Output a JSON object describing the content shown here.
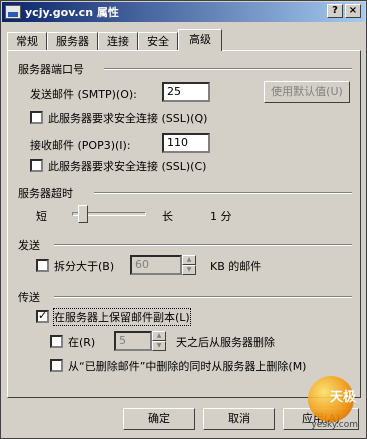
{
  "window": {
    "title": "ycjy.gov.cn 属性",
    "help_label": "?",
    "close_label": "×"
  },
  "tabs": [
    "常规",
    "服务器",
    "连接",
    "安全",
    "高级"
  ],
  "active_tab": "高级",
  "ports": {
    "group_title": "服务器端口号",
    "smtp_label": "发送邮件 (SMTP)(O):",
    "smtp_value": "25",
    "default_button": "使用默认值(U)",
    "smtp_ssl_label": "此服务器要求安全连接 (SSL)(Q)",
    "pop3_label": "接收邮件 (POP3)(I):",
    "pop3_value": "110",
    "pop3_ssl_label": "此服务器要求安全连接 (SSL)(C)"
  },
  "timeout": {
    "group_title": "服务器超时",
    "short_label": "短",
    "long_label": "长",
    "value": "1 分",
    "level": 0.1
  },
  "send": {
    "group_title": "发送",
    "split_label": "拆分大于(B)",
    "split_value": "60",
    "unit_label": "KB 的邮件"
  },
  "delivery": {
    "group_title": "传送",
    "keep_copy_label": "在服务器上保留邮件副本(L)",
    "keep_copy_checked": true,
    "remove_after_label": "在(R)",
    "remove_after_value": "5",
    "remove_after_suffix": "天之后从服务器删除",
    "remove_deleted_label": "从“已删除邮件”中删除的同时从服务器上删除(M)"
  },
  "footer": {
    "ok": "确定",
    "cancel": "取消",
    "apply": "应用(A)"
  },
  "watermark": {
    "brand": "天极",
    "site": "yesky.com"
  }
}
